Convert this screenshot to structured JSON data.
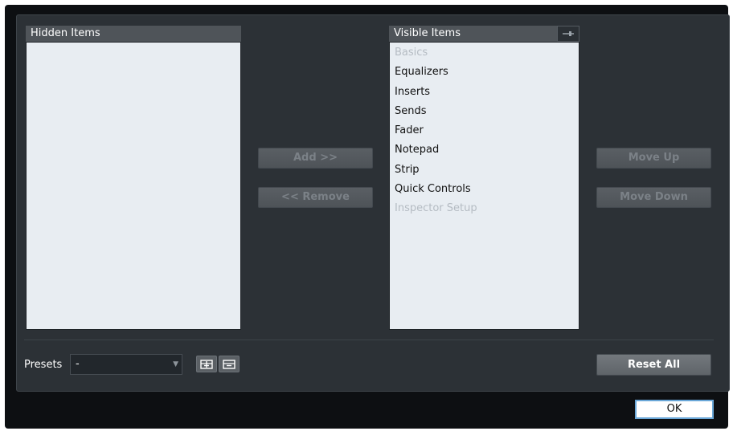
{
  "hidden_list": {
    "header": "Hidden Items",
    "items": []
  },
  "visible_list": {
    "header": "Visible Items",
    "pin_icon": "pin-icon",
    "items": [
      {
        "label": "Basics",
        "enabled": false
      },
      {
        "label": "Equalizers",
        "enabled": true
      },
      {
        "label": "Inserts",
        "enabled": true
      },
      {
        "label": "Sends",
        "enabled": true
      },
      {
        "label": "Fader",
        "enabled": true
      },
      {
        "label": "Notepad",
        "enabled": true
      },
      {
        "label": "Strip",
        "enabled": true
      },
      {
        "label": "Quick Controls",
        "enabled": true
      },
      {
        "label": "Inspector Setup",
        "enabled": false
      }
    ]
  },
  "buttons": {
    "add": "Add >>",
    "remove": "<< Remove",
    "move_up": "Move Up",
    "move_down": "Move Down",
    "reset_all": "Reset All",
    "ok": "OK"
  },
  "presets": {
    "label": "Presets",
    "value": "-",
    "save_icon": "save-preset-icon",
    "delete_icon": "delete-preset-icon"
  },
  "colors": {
    "list_background": "#e8edf2",
    "panel_background": "#2c3136",
    "ok_border": "#6aa7d8"
  }
}
